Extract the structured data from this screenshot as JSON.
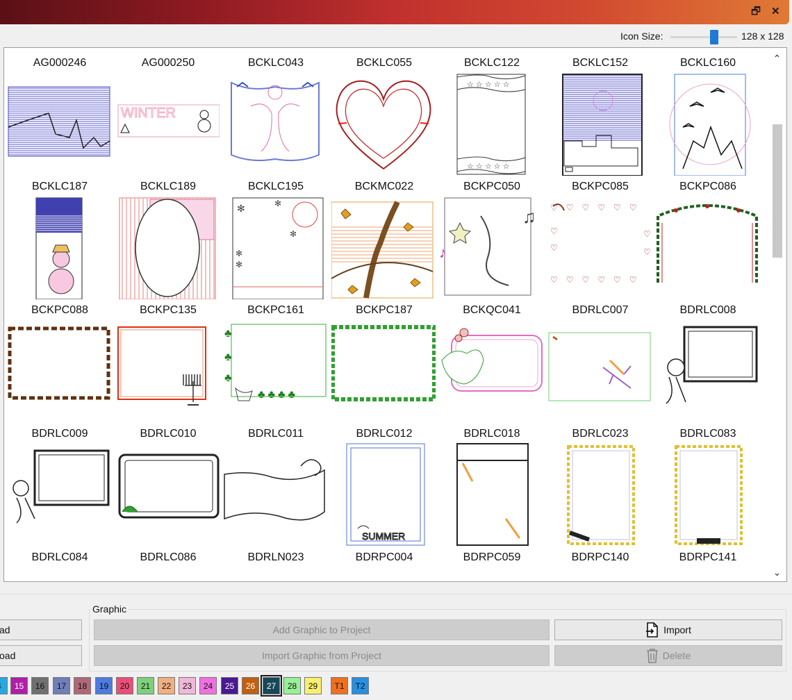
{
  "window": {
    "restore_glyph": "🗗",
    "close_glyph": "✕"
  },
  "icon_size": {
    "label": "Icon Size:",
    "value": "128 x 128",
    "slider_level": 0.66
  },
  "gallery": {
    "items": [
      {
        "name": "AG000246",
        "art": "night-city"
      },
      {
        "name": "AG000250",
        "art": "winter-banner"
      },
      {
        "name": "BCKLC043",
        "art": "couple-frame"
      },
      {
        "name": "BCKLC055",
        "art": "heart"
      },
      {
        "name": "BCKLC122",
        "art": "stars-banner"
      },
      {
        "name": "BCKLC152",
        "art": "witch-city"
      },
      {
        "name": "BCKLC160",
        "art": "bats"
      },
      {
        "name": "BCKLC187",
        "art": "snowman"
      },
      {
        "name": "BCKLC189",
        "art": "flag-oval"
      },
      {
        "name": "BCKLC195",
        "art": "flowers-circle"
      },
      {
        "name": "BCKMC022",
        "art": "autumn-tree"
      },
      {
        "name": "BCKPC050",
        "art": "music"
      },
      {
        "name": "BCKPC085",
        "art": "hearts-border"
      },
      {
        "name": "BCKPC086",
        "art": "holly-arch"
      },
      {
        "name": "BCKPC088",
        "art": "leaf-border"
      },
      {
        "name": "BCKPC135",
        "art": "menorah"
      },
      {
        "name": "BCKPC161",
        "art": "clover"
      },
      {
        "name": "BCKPC187",
        "art": "trees-border"
      },
      {
        "name": "BCKQC041",
        "art": "holly-frame"
      },
      {
        "name": "BDRLC007",
        "art": "fireworks"
      },
      {
        "name": "BDRLC008",
        "art": "elf-frame"
      },
      {
        "name": "BDRLC009",
        "art": "elf-frame-2"
      },
      {
        "name": "BDRLC010",
        "art": "scroll-frame"
      },
      {
        "name": "BDRLC011",
        "art": "scroll-banner"
      },
      {
        "name": "BDRLC012",
        "art": "summer"
      },
      {
        "name": "BDRLC018",
        "art": "champagne"
      },
      {
        "name": "BDRLC023",
        "art": "gold-frame"
      },
      {
        "name": "BDRLC083",
        "art": "gold-frame-2"
      },
      {
        "name": "BDRLC084",
        "art": "partial"
      },
      {
        "name": "BDRLC086",
        "art": "partial"
      },
      {
        "name": "BDRLN023",
        "art": "partial"
      },
      {
        "name": "BDRPC004",
        "art": "partial"
      },
      {
        "name": "BDRPC059",
        "art": "partial"
      },
      {
        "name": "BDRPC140",
        "art": "partial"
      },
      {
        "name": "BDRPC141",
        "art": "partial"
      }
    ]
  },
  "left_buttons": {
    "load_1": "ad",
    "load_2": "oad"
  },
  "graphic_group": {
    "legend": "Graphic",
    "add_to_project": "Add Graphic to Project",
    "import_from_project": "Import Graphic from Project",
    "import": "Import",
    "delete": "Delete"
  },
  "palette": [
    {
      "label": "4",
      "color": "#29a8e0"
    },
    {
      "label": "15",
      "color": "#b01fa8"
    },
    {
      "label": "16",
      "color": "#707070"
    },
    {
      "label": "17",
      "color": "#6f7fb8"
    },
    {
      "label": "18",
      "color": "#b06878"
    },
    {
      "label": "19",
      "color": "#4e7be0"
    },
    {
      "label": "20",
      "color": "#e8507a"
    },
    {
      "label": "21",
      "color": "#7ed07a"
    },
    {
      "label": "22",
      "color": "#f0b080"
    },
    {
      "label": "23",
      "color": "#f0b8d8"
    },
    {
      "label": "24",
      "color": "#f070e0"
    },
    {
      "label": "25",
      "color": "#4a1890"
    },
    {
      "label": "26",
      "color": "#c06010"
    },
    {
      "label": "27",
      "color": "#184858"
    },
    {
      "label": "28",
      "color": "#98f098"
    },
    {
      "label": "29",
      "color": "#f8f070"
    },
    {
      "label": "T1",
      "color": "#f07020"
    },
    {
      "label": "T2",
      "color": "#2890e0"
    }
  ]
}
